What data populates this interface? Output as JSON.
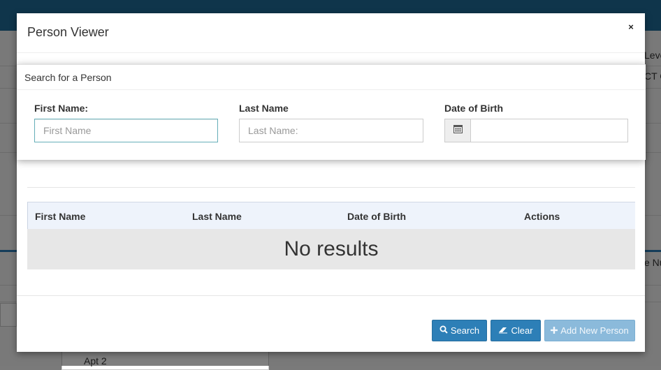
{
  "background": {
    "header_fragment_right": "Leve",
    "subheader_fragment_right": "CT C",
    "table_fragment_right": "e Nu",
    "address_fragment": "Apt  2"
  },
  "modal": {
    "title": "Person Viewer",
    "close_label": "×"
  },
  "search_panel": {
    "title": "Search for a Person",
    "first_name_label": "First Name:",
    "first_name_placeholder": "First Name",
    "first_name_value": "",
    "last_name_label": "Last Name",
    "last_name_placeholder": "Last Name:",
    "last_name_value": "",
    "dob_label": "Date of Birth",
    "dob_value": "",
    "calendar_icon": "calendar-icon"
  },
  "results_table": {
    "columns": [
      "First Name",
      "Last Name",
      "Date of Birth",
      "Actions"
    ],
    "rows": [],
    "empty_message": "No results"
  },
  "buttons": {
    "search_label": "Search",
    "search_icon": "search-icon",
    "clear_label": "Clear",
    "clear_icon": "eraser-icon",
    "add_label": "Add New Person",
    "add_icon": "plus-icon"
  },
  "colors": {
    "primary": "#2d7fb7",
    "primary_disabled": "#8bbadb",
    "app_header": "#1f6a97",
    "table_header_bg": "#eef3fb"
  }
}
